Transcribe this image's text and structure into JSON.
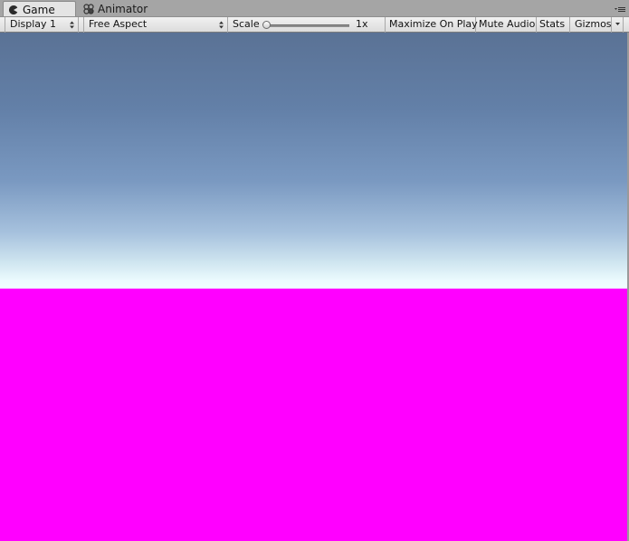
{
  "tabs": [
    {
      "label": "Game",
      "icon": "pacman-icon",
      "active": true
    },
    {
      "label": "Animator",
      "icon": "animator-icon",
      "active": false
    }
  ],
  "toolbar": {
    "display": "Display 1",
    "aspect": "Free Aspect",
    "scale_label": "Scale",
    "scale_value": "1x",
    "scale_level": 0,
    "maximize_on_play": "Maximize On Play",
    "mute_audio": "Mute Audio",
    "stats": "Stats",
    "gizmos": "Gizmos"
  },
  "colors": {
    "sky_top": "#5a7295",
    "sky_horizon": "#f0ffff",
    "ground": "#ff00ff"
  }
}
